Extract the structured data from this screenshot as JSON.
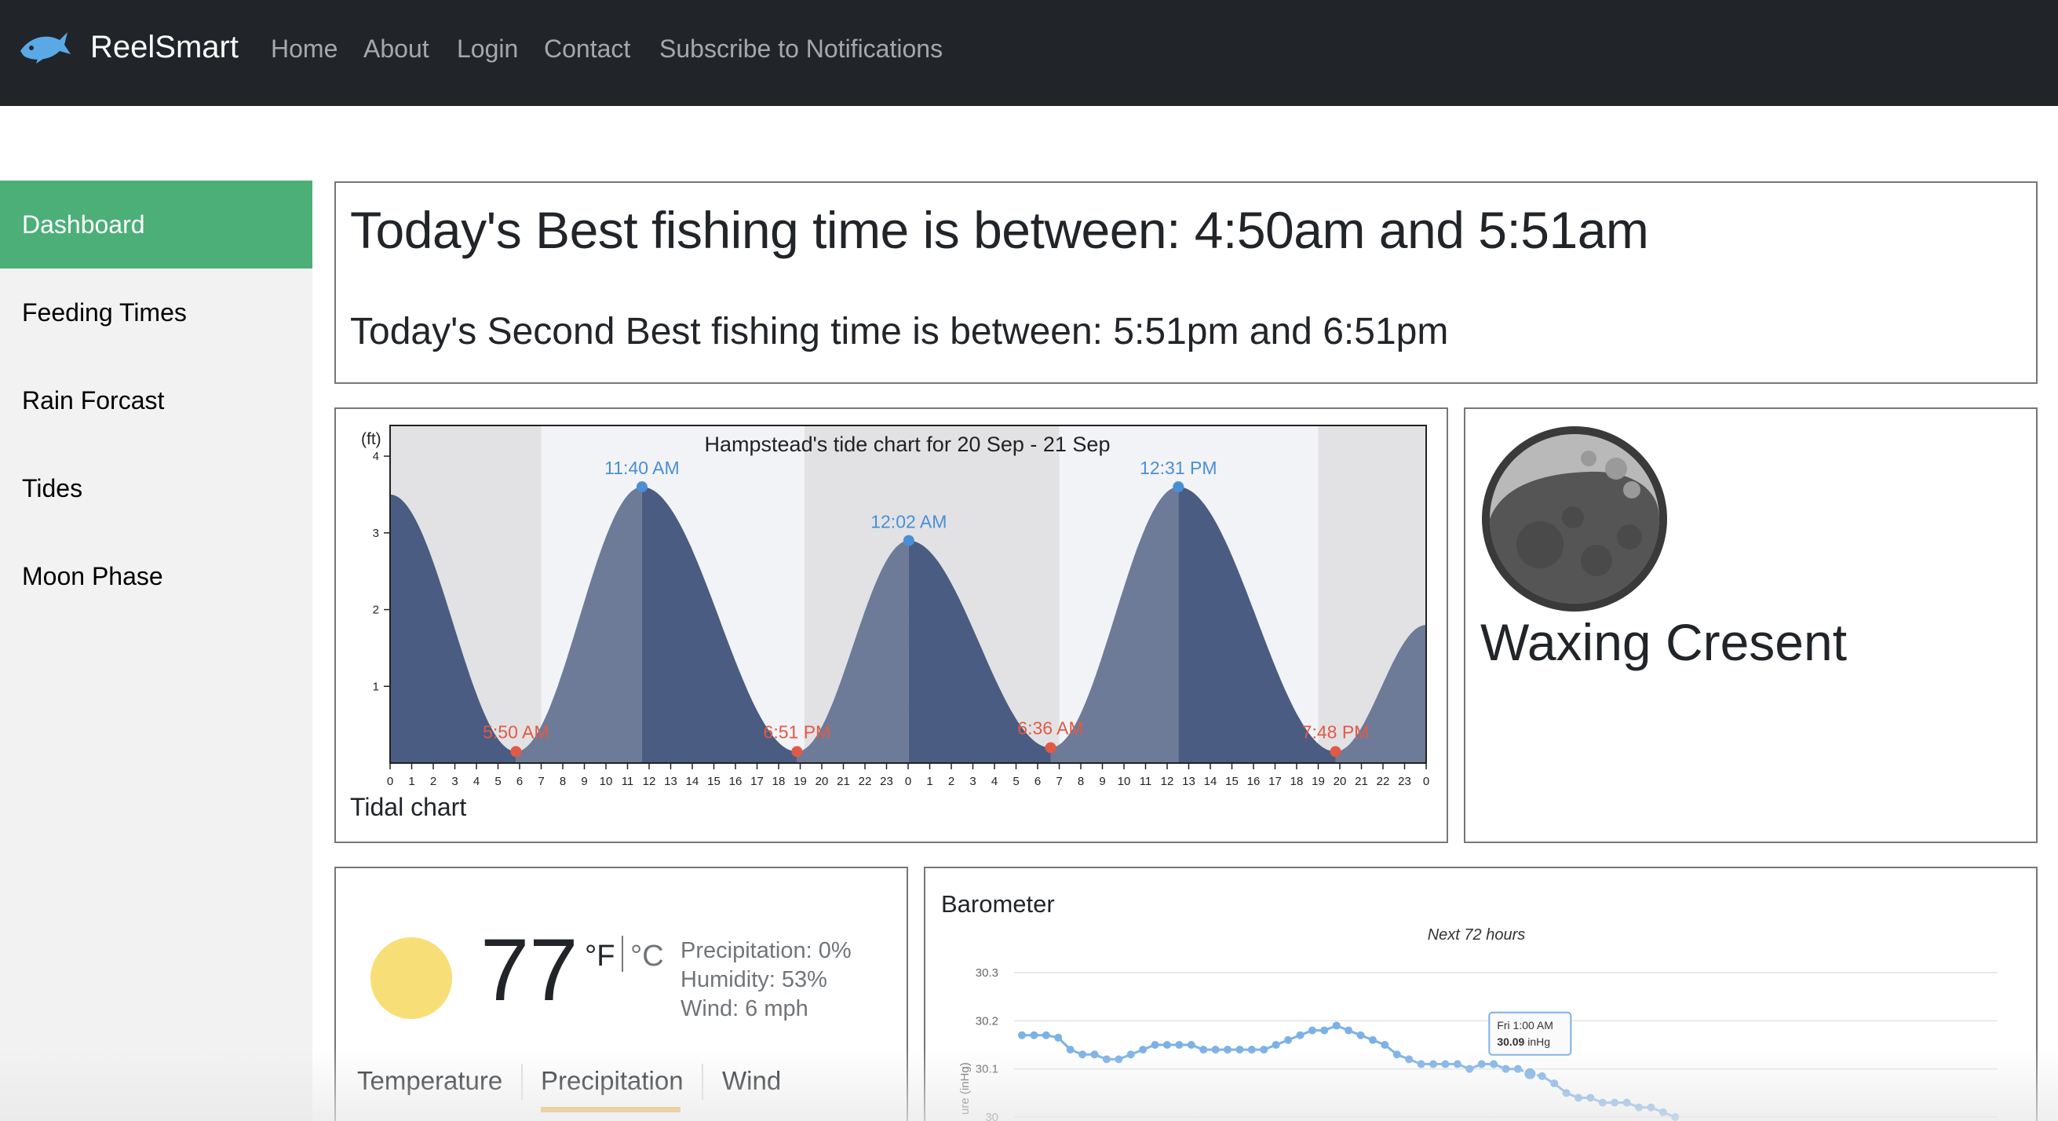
{
  "nav": {
    "brand": "ReelSmart",
    "links": [
      "Home",
      "About",
      "Login",
      "Contact",
      "Subscribe to Notifications"
    ]
  },
  "sidebar": {
    "items": [
      {
        "label": "Dashboard",
        "active": true
      },
      {
        "label": "Feeding Times",
        "active": false
      },
      {
        "label": "Rain Forcast",
        "active": false
      },
      {
        "label": "Tides",
        "active": false
      },
      {
        "label": "Moon Phase",
        "active": false
      }
    ]
  },
  "best_time": {
    "primary": "Today's Best fishing time is between: 4:50am and 5:51am",
    "secondary": "Today's Second Best fishing time is between: 5:51pm and 6:51pm"
  },
  "tidal": {
    "card_title": "Tidal chart"
  },
  "moon": {
    "phase": "Waxing Cresent"
  },
  "weather": {
    "temperature": "77",
    "unit_f": "°F",
    "unit_c": "°C",
    "precipitation": "Precipitation: 0%",
    "humidity": "Humidity: 53%",
    "wind": "Wind: 6 mph",
    "tabs": [
      "Temperature",
      "Precipitation",
      "Wind"
    ],
    "active_tab": "Precipitation",
    "icon": "sun-icon"
  },
  "barometer": {
    "title": "Barometer"
  },
  "chart_data": [
    {
      "type": "area",
      "title": "Hampstead's tide chart for 20 Sep - 21 Sep",
      "ylabel": "(ft)",
      "ylim": [
        0,
        4.4
      ],
      "yticks": [
        "1",
        "2",
        "3",
        "4"
      ],
      "xticks": [
        "0",
        "1",
        "2",
        "3",
        "4",
        "5",
        "6",
        "7",
        "8",
        "9",
        "10",
        "11",
        "12",
        "13",
        "14",
        "15",
        "16",
        "17",
        "18",
        "19",
        "20",
        "21",
        "22",
        "23",
        "0",
        "1",
        "2",
        "3",
        "4",
        "5",
        "6",
        "7",
        "8",
        "9",
        "10",
        "11",
        "12",
        "13",
        "14",
        "15",
        "16",
        "17",
        "18",
        "19",
        "20",
        "21",
        "22",
        "23",
        "0"
      ],
      "xlim_hours": [
        0,
        48
      ],
      "highs": [
        {
          "label": "11:40 AM",
          "hour": 11.67,
          "ft": 3.6
        },
        {
          "label": "12:02 AM",
          "hour": 24.03,
          "ft": 2.9
        },
        {
          "label": "12:31 PM",
          "hour": 36.52,
          "ft": 3.6
        }
      ],
      "lows": [
        {
          "label": "5:50 AM",
          "hour": 5.83,
          "ft": 0.15
        },
        {
          "label": "6:51 PM",
          "hour": 18.85,
          "ft": 0.15
        },
        {
          "label": "6:36 AM",
          "hour": 30.6,
          "ft": 0.2
        },
        {
          "label": "7:48 PM",
          "hour": 43.8,
          "ft": 0.15
        }
      ],
      "start_ft": 3.5,
      "end_ft": 1.8,
      "night_bands_hours": [
        [
          0,
          7
        ],
        [
          19.2,
          31
        ],
        [
          43,
          48
        ]
      ],
      "grid": false
    },
    {
      "type": "line",
      "title": "Next 72 hours",
      "ylabel": "ure (inHg)",
      "yticks": [
        "30",
        "30.1",
        "30.2",
        "30.3"
      ],
      "ylim": [
        30.0,
        30.3
      ],
      "series": [
        {
          "values": [
            30.17,
            30.17,
            30.17,
            30.165,
            30.14,
            30.13,
            30.13,
            30.12,
            30.12,
            30.13,
            30.14,
            30.15,
            30.15,
            30.15,
            30.15,
            30.14,
            30.14,
            30.14,
            30.14,
            30.14,
            30.14,
            30.15,
            30.16,
            30.17,
            30.18,
            30.18,
            30.19,
            30.18,
            30.17,
            30.16,
            30.15,
            30.13,
            30.12,
            30.11,
            30.11,
            30.11,
            30.11,
            30.1,
            30.11,
            30.11,
            30.1,
            30.1,
            30.09,
            30.085,
            30.07,
            30.05,
            30.04,
            30.04,
            30.03,
            30.03,
            30.03,
            30.02,
            30.02,
            30.01,
            30.0
          ]
        }
      ],
      "tooltip": {
        "time": "Fri 1:00 AM",
        "value": "30.09",
        "unit": "inHg"
      },
      "grid": true
    }
  ]
}
